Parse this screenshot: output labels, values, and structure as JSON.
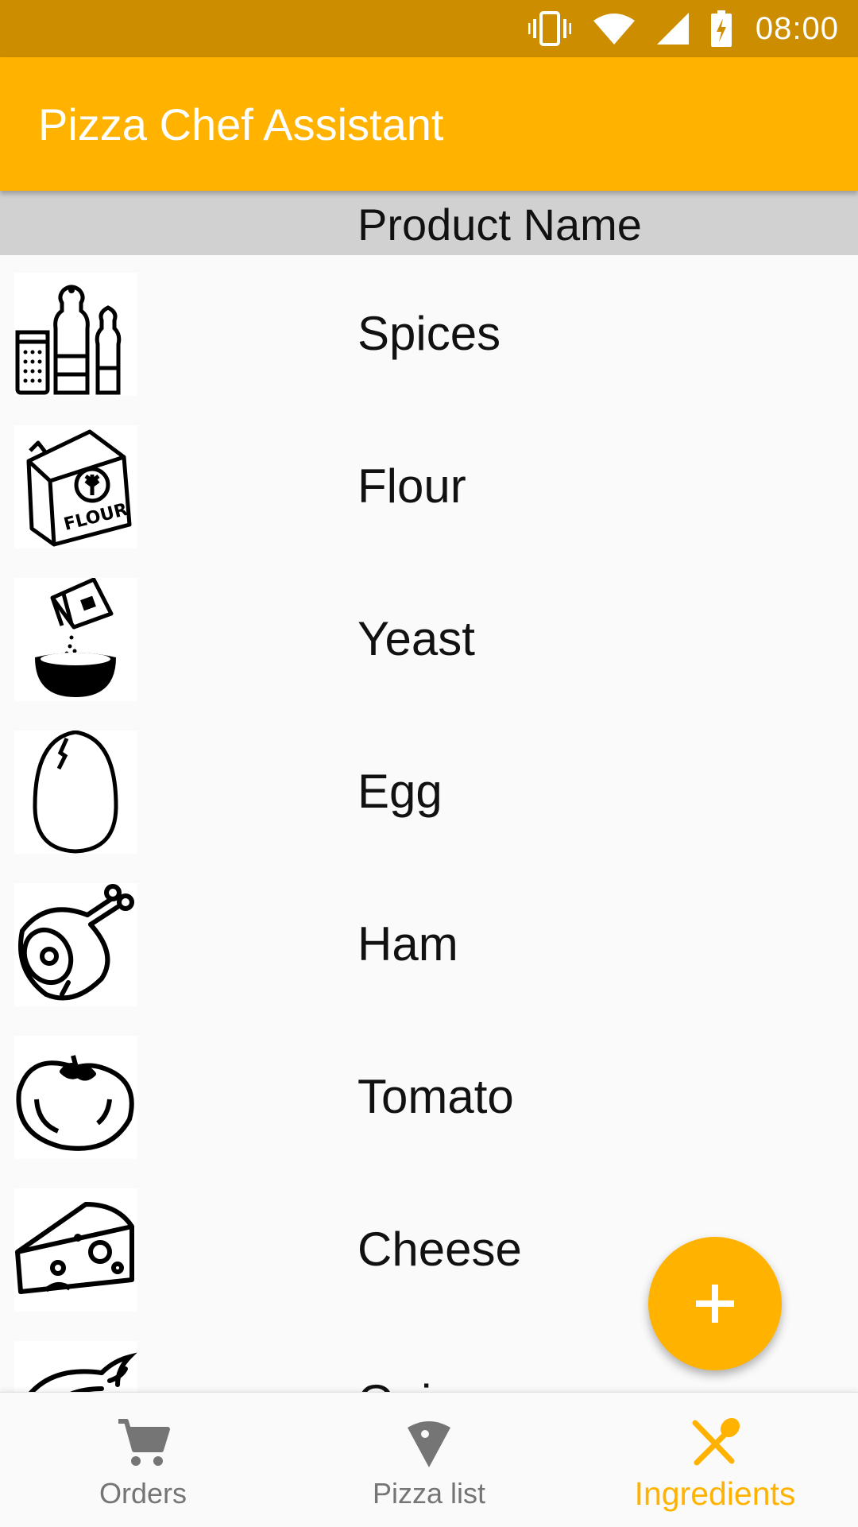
{
  "status_bar": {
    "time": "08:00",
    "icons": [
      "vibrate-icon",
      "wifi-icon",
      "signal-icon",
      "battery-charging-icon"
    ]
  },
  "app_bar": {
    "title": "Pizza Chef Assistant"
  },
  "list": {
    "header": "Product Name",
    "items": [
      {
        "label": "Spices",
        "icon": "spices-icon"
      },
      {
        "label": "Flour",
        "icon": "flour-icon"
      },
      {
        "label": "Yeast",
        "icon": "yeast-icon"
      },
      {
        "label": "Egg",
        "icon": "egg-icon"
      },
      {
        "label": "Ham",
        "icon": "ham-icon"
      },
      {
        "label": "Tomato",
        "icon": "tomato-icon"
      },
      {
        "label": "Cheese",
        "icon": "cheese-icon"
      },
      {
        "label": "Onion",
        "icon": "onion-icon"
      }
    ]
  },
  "fab": {
    "icon": "plus-icon"
  },
  "bottom_nav": {
    "items": [
      {
        "label": "Orders",
        "icon": "cart-icon",
        "active": false
      },
      {
        "label": "Pizza list",
        "icon": "pizza-slice-icon",
        "active": false
      },
      {
        "label": "Ingredients",
        "icon": "utensils-icon",
        "active": true
      }
    ]
  },
  "colors": {
    "status_bar": "#cc8e00",
    "primary": "#ffb300",
    "header_bg": "#d1d1d1",
    "inactive_nav": "#757575"
  }
}
